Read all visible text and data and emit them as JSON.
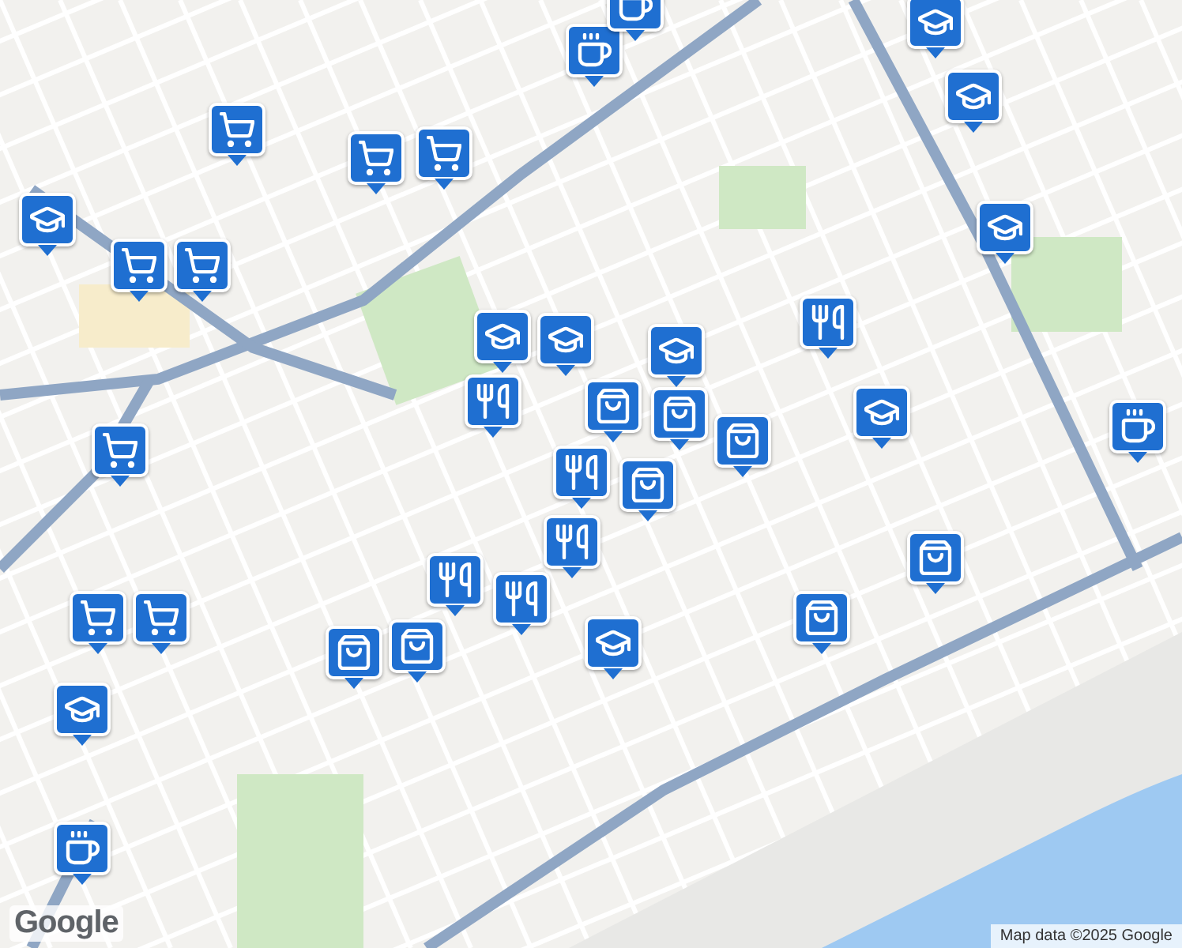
{
  "markers": [
    {
      "kind": "cafe"
    },
    {
      "kind": "cafe"
    },
    {
      "kind": "school"
    },
    {
      "kind": "school"
    },
    {
      "kind": "cart"
    },
    {
      "kind": "cart"
    },
    {
      "kind": "cart"
    },
    {
      "kind": "school"
    },
    {
      "kind": "cart"
    },
    {
      "kind": "cart"
    },
    {
      "kind": "school"
    },
    {
      "kind": "school"
    },
    {
      "kind": "school"
    },
    {
      "kind": "restaurant"
    },
    {
      "kind": "school"
    },
    {
      "kind": "restaurant"
    },
    {
      "kind": "school"
    },
    {
      "kind": "bag"
    },
    {
      "kind": "cafe"
    },
    {
      "kind": "bag"
    },
    {
      "kind": "bag"
    },
    {
      "kind": "cart"
    },
    {
      "kind": "restaurant"
    },
    {
      "kind": "bag"
    },
    {
      "kind": "restaurant"
    },
    {
      "kind": "bag"
    },
    {
      "kind": "restaurant"
    },
    {
      "kind": "restaurant"
    },
    {
      "kind": "cart"
    },
    {
      "kind": "cart"
    },
    {
      "kind": "bag"
    },
    {
      "kind": "bag"
    },
    {
      "kind": "school"
    },
    {
      "kind": "bag"
    },
    {
      "kind": "school"
    },
    {
      "kind": "cafe"
    }
  ],
  "logo": "Google",
  "attribution": "Map data ©2025 Google"
}
